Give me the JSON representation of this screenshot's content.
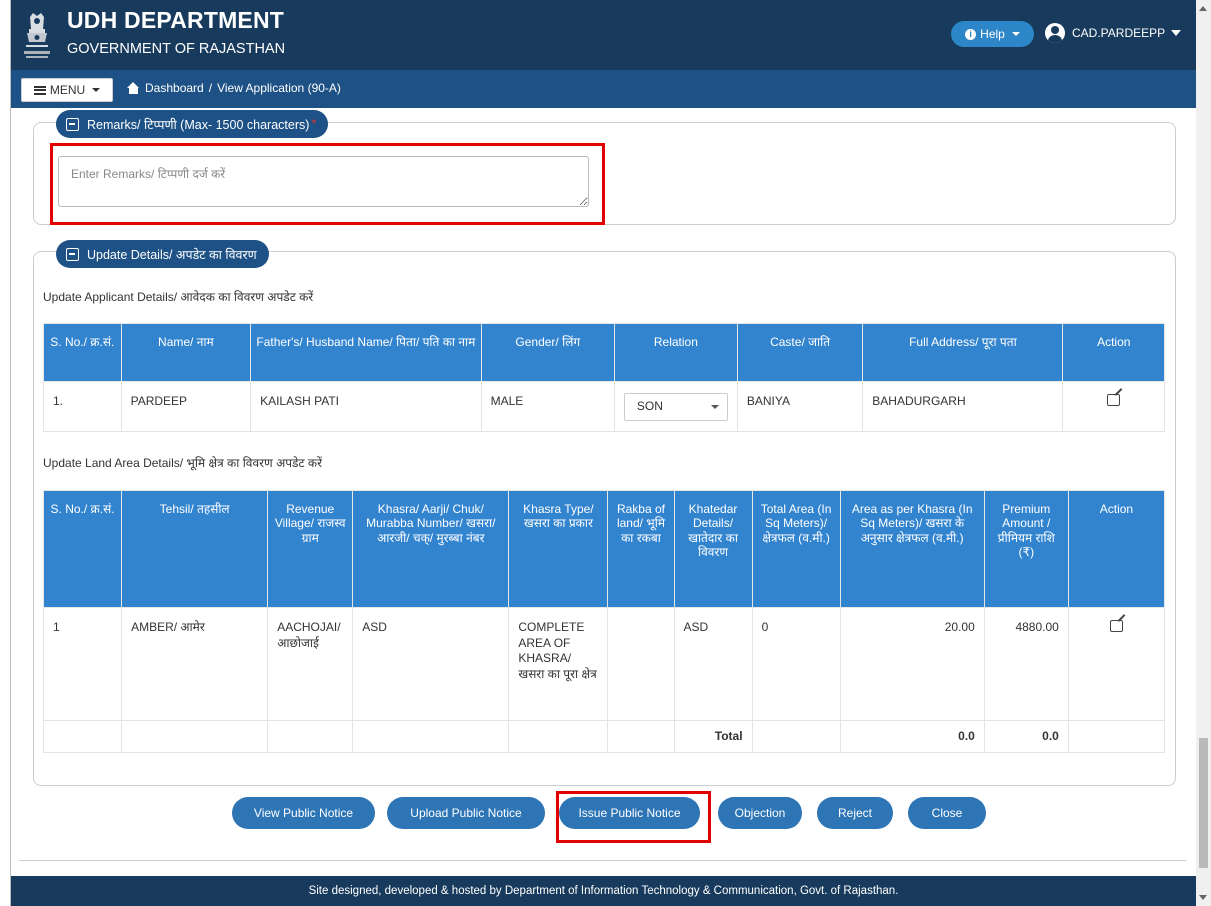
{
  "header": {
    "title": "UDH DEPARTMENT",
    "subtitle": "GOVERNMENT OF RAJASTHAN",
    "help_label": "Help",
    "username": "CAD.PARDEEPP"
  },
  "nav": {
    "menu_label": "MENU",
    "breadcrumb": [
      "Dashboard",
      "/",
      "View Application (90-A)"
    ]
  },
  "remarks": {
    "legend": "Remarks/ टिप्पणी (Max- 1500 characters)",
    "required_mark": "*",
    "placeholder": "Enter Remarks/ टिप्पणी दर्ज करें",
    "value": ""
  },
  "update_details": {
    "legend": "Update Details/ अपडेट का विवरण",
    "applicant_title": "Update Applicant Details/ आवेदक का विवरण अपडेट करें",
    "applicant_table": {
      "headers": [
        "S. No./ क्र.सं.",
        "Name/ नाम",
        "Father's/ Husband Name/ पिता/ पति का नाम",
        "Gender/ लिंग",
        "Relation",
        "Caste/ जाति",
        "Full Address/ पूरा पता",
        "Action"
      ],
      "rows": [
        {
          "sno": "1.",
          "name": "PARDEEP",
          "father": "KAILASH PATI",
          "gender": "MALE",
          "relation": "SON",
          "caste": "BANIYA",
          "address": "BAHADURGARH"
        }
      ]
    },
    "land_title": "Update Land Area Details/ भूमि क्षेत्र का विवरण अपडेट करें",
    "land_table": {
      "headers": [
        "S. No./ क्र.सं.",
        "Tehsil/ तहसील",
        "Revenue Village/ राजस्व ग्राम",
        "Khasra/ Aarji/ Chuk/ Murabba Number/ खसरा/ आरजी/ चक्/ मुरब्बा नंबर",
        "Khasra Type/ खसरा का प्रकार",
        "Rakba of land/ भूमि का रकबा",
        "Khatedar Details/ खातेदार का विवरण",
        "Total Area (In Sq Meters)/ क्षेत्रफल (व.मी.)",
        "Area as per Khasra (In Sq Meters)/ खसरा के अनुसार क्षेत्रफल (व.मी.)",
        "Premium Amount / प्रीमियम राशि (₹)",
        "Action"
      ],
      "rows": [
        {
          "sno": "1",
          "tehsil": "AMBER/ आमेर",
          "village": "AACHOJAI/ आछोजाई",
          "khasra": "ASD",
          "khasra_type": "COMPLETE AREA OF KHASRA/ खसरा का पूरा क्षेत्र",
          "rakba": "",
          "khatedar": "ASD",
          "total_area": "0",
          "area_khasra": "20.00",
          "premium": "4880.00"
        }
      ],
      "total": {
        "label": "Total",
        "area_khasra": "0.0",
        "premium": "0.0"
      }
    }
  },
  "actions": {
    "view_public_notice": "View Public Notice",
    "upload_public_notice": "Upload Public Notice",
    "issue_public_notice": "Issue Public Notice",
    "objection": "Objection",
    "reject": "Reject",
    "close": "Close"
  },
  "footer": {
    "text": "Site designed, developed & hosted by Department of Information Technology & Communication, Govt. of Rajasthan."
  },
  "colors": {
    "header_bg": "#183a5c",
    "nav_bg": "#1e5286",
    "table_header": "#3384cf",
    "button": "#2e75b6",
    "highlight": "#e50000"
  }
}
